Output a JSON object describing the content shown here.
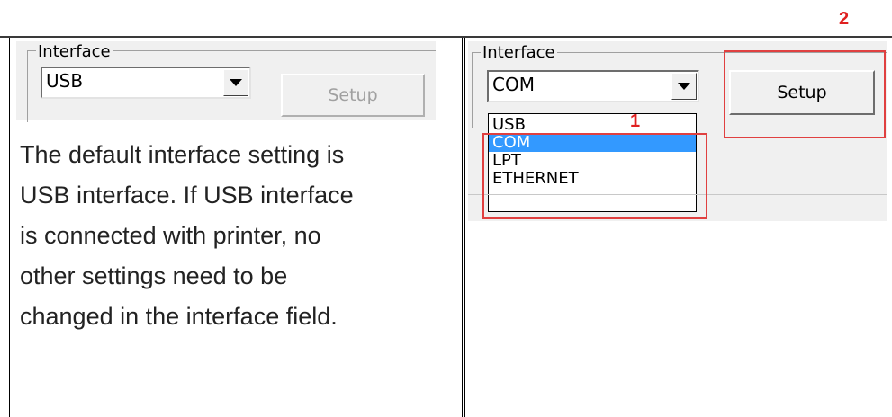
{
  "callouts": {
    "one": "1",
    "two": "2"
  },
  "left": {
    "group_label": "Interface",
    "combo_value": "USB",
    "setup_label": "Setup",
    "description_lines": [
      "The default interface setting is",
      "USB interface. If USB interface",
      "is connected with printer, no",
      "other settings need to be",
      "changed in the interface field."
    ]
  },
  "right": {
    "group_label": "Interface",
    "combo_value": "COM",
    "setup_label": "Setup",
    "options": [
      "USB",
      "COM",
      "LPT",
      "ETHERNET"
    ],
    "selected_option": "COM"
  },
  "colors": {
    "highlight": "#3399ff",
    "callout": "#e04040"
  }
}
